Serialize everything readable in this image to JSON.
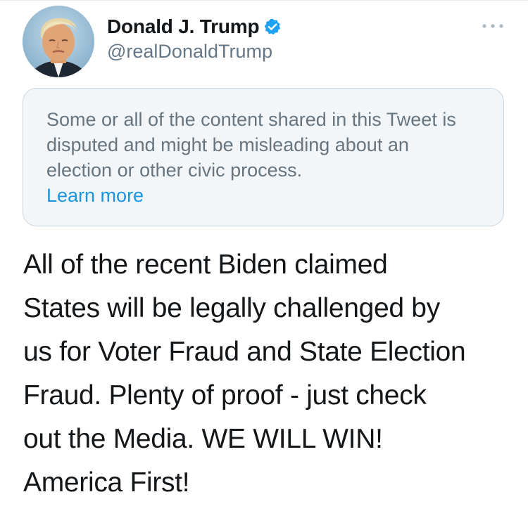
{
  "tweet": {
    "author": {
      "display_name": "Donald J. Trump",
      "handle": "@realDonaldTrump",
      "verified": true,
      "avatar_icon": "profile-photo"
    },
    "notice": {
      "text": "Some or all of the content shared in this Tweet is disputed and might be misleading about an election or other civic process.",
      "link_label": "Learn more"
    },
    "body": "All of the recent Biden claimed\nStates will be legally challenged by\nus for Voter Fraud and State Election\nFraud. Plenty of proof - just check\nout the Media. WE WILL WIN!\nAmerica First!",
    "more_icon": "more-horizontal-icon"
  },
  "colors": {
    "name": "#14171a",
    "handle": "#657786",
    "verified": "#1da1f2",
    "link": "#1b95e0",
    "notice_bg": "#f3f6f9",
    "notice_border": "#ccd6dd",
    "notice_text": "#66757f"
  }
}
